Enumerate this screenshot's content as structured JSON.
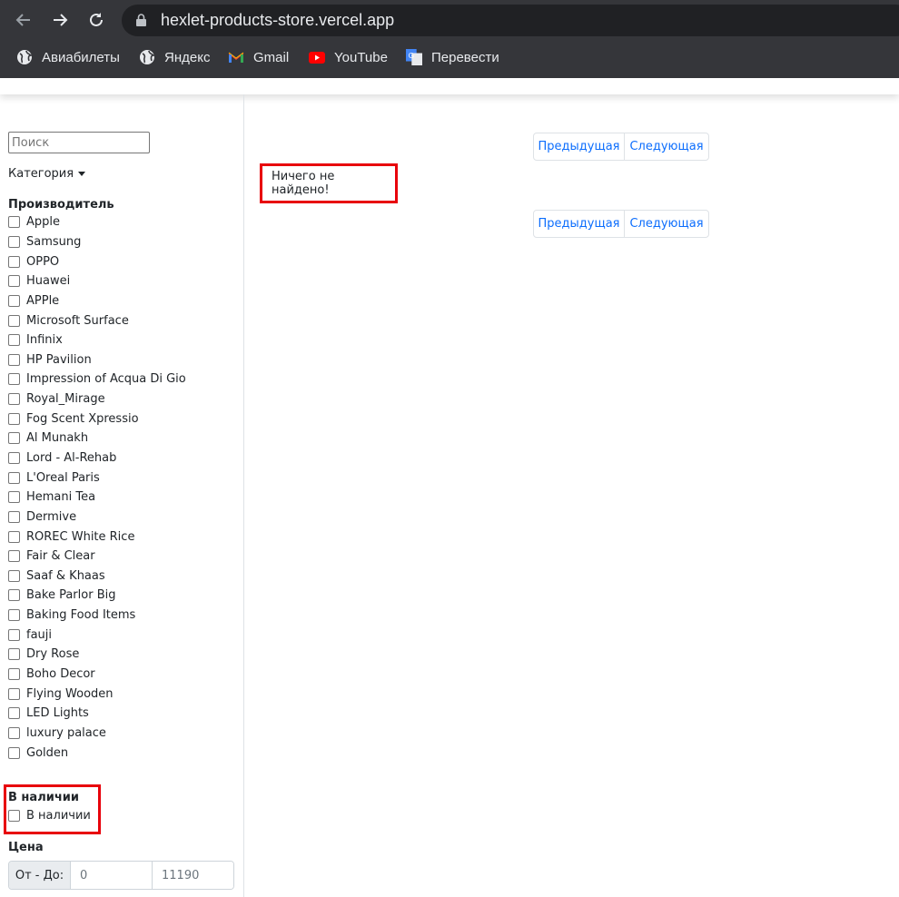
{
  "browser": {
    "url": "hexlet-products-store.vercel.app",
    "bookmarks": [
      {
        "label": "Авиабилеты",
        "icon": "globe-icon"
      },
      {
        "label": "Яндекс",
        "icon": "globe-icon"
      },
      {
        "label": "Gmail",
        "icon": "gmail-icon"
      },
      {
        "label": "YouTube",
        "icon": "youtube-icon"
      },
      {
        "label": "Перевести",
        "icon": "translate-icon"
      }
    ]
  },
  "sidebar": {
    "search_placeholder": "Поиск",
    "category_label": "Категория",
    "manufacturer_title": "Производитель",
    "brands": [
      "Apple",
      "Samsung",
      "OPPO",
      "Huawei",
      "APPle",
      "Microsoft Surface",
      "Infinix",
      "HP Pavilion",
      "Impression of Acqua Di Gio",
      "Royal_Mirage",
      "Fog Scent Xpressio",
      "Al Munakh",
      "Lord - Al-Rehab",
      "L'Oreal Paris",
      "Hemani Tea",
      "Dermive",
      "ROREC White Rice",
      "Fair & Clear",
      "Saaf & Khaas",
      "Bake Parlor Big",
      "Baking Food Items",
      "fauji",
      "Dry Rose",
      "Boho Decor",
      "Flying Wooden",
      "LED Lights",
      "luxury palace",
      "Golden"
    ],
    "in_stock_title": "В наличии",
    "in_stock_label": "В наличии",
    "price_title": "Цена",
    "price_range_label": "От - До:",
    "price_min": "0",
    "price_max": "11190"
  },
  "main": {
    "prev_label": "Предыдущая",
    "next_label": "Следующая",
    "empty_message": "Ничего не найдено!"
  },
  "colors": {
    "highlight": "#e8000b",
    "link": "#0d6efd",
    "chrome_bg": "#35363a"
  }
}
